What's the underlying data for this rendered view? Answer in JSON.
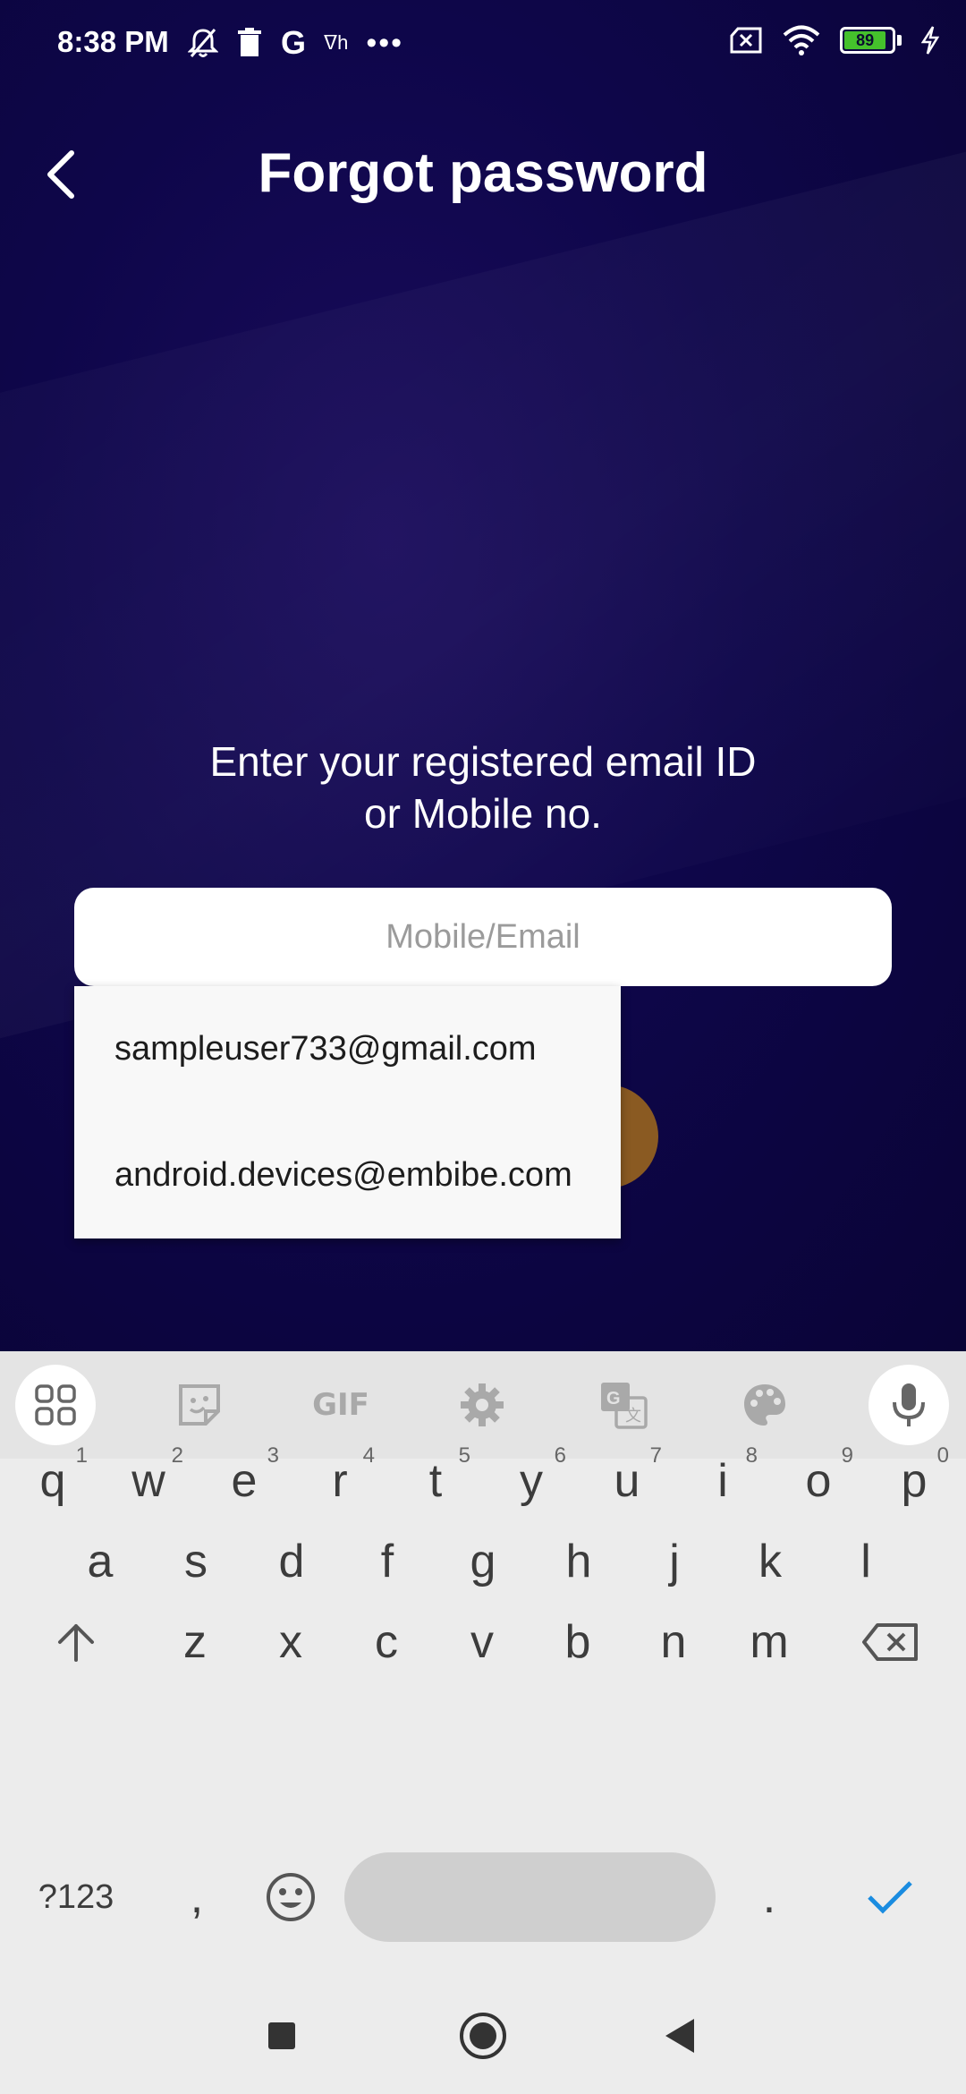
{
  "status_bar": {
    "time": "8:38 PM",
    "battery_level": "89",
    "icons": [
      "mute-icon",
      "delete-icon",
      "google-icon",
      "translate-icon",
      "more-dots-icon",
      "no-sim-icon",
      "wifi-icon",
      "battery-icon",
      "charging-icon"
    ]
  },
  "header": {
    "title": "Forgot password",
    "back_icon": "chevron-left-icon"
  },
  "form": {
    "prompt_line1": "Enter your registered email ID",
    "prompt_line2": "or Mobile no.",
    "input_placeholder": "Mobile/Email",
    "input_value": ""
  },
  "autofill": {
    "suggestions": [
      "sampleuser733@gmail.com",
      "android.devices@embibe.com"
    ]
  },
  "keyboard": {
    "toolbar": [
      "apps-icon",
      "sticker-icon",
      "GIF",
      "settings-icon",
      "translate-icon",
      "palette-icon",
      "microphone-icon"
    ],
    "gif_label": "GIF",
    "row1": [
      "q",
      "w",
      "e",
      "r",
      "t",
      "y",
      "u",
      "i",
      "o",
      "p"
    ],
    "row1_hints": [
      "1",
      "2",
      "3",
      "4",
      "5",
      "6",
      "7",
      "8",
      "9",
      "0"
    ],
    "row2": [
      "a",
      "s",
      "d",
      "f",
      "g",
      "h",
      "j",
      "k",
      "l"
    ],
    "row3": [
      "z",
      "x",
      "c",
      "v",
      "b",
      "n",
      "m"
    ],
    "symbols_label": "?123",
    "comma": ",",
    "period": "."
  },
  "nav_bar": [
    "recents-icon",
    "home-icon",
    "back-icon"
  ]
}
